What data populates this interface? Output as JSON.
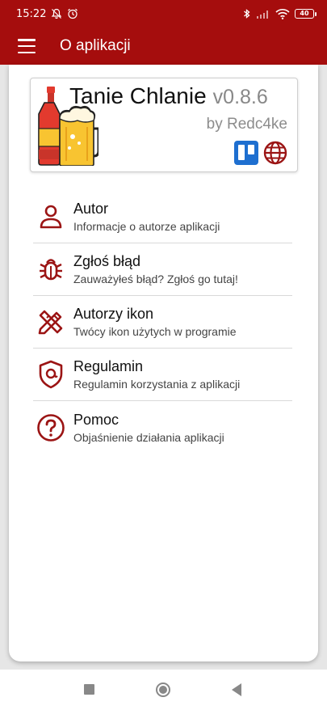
{
  "status_bar": {
    "time": "15:22",
    "battery": "40"
  },
  "app_bar": {
    "title": "O aplikacji"
  },
  "about": {
    "app_name": "Tanie Chlanie",
    "version": "v0.8.6",
    "author": "by Redc4ke"
  },
  "menu": [
    {
      "icon": "user-icon",
      "title": "Autor",
      "description": "Informacje o autorze aplikacji"
    },
    {
      "icon": "bug-icon",
      "title": "Zgłoś błąd",
      "description": "Zauważyłeś błąd? Zgłoś go tutaj!"
    },
    {
      "icon": "design-tools-icon",
      "title": "Autorzy ikon",
      "description": "Twócy ikon użytych w programie"
    },
    {
      "icon": "shield-icon",
      "title": "Regulamin",
      "description": "Regulamin korzystania z aplikacji"
    },
    {
      "icon": "help-icon",
      "title": "Pomoc",
      "description": "Objaśnienie działania aplikacji"
    }
  ],
  "colors": {
    "primary": "#a50d0d",
    "icon_red": "#9b1414",
    "trello_blue": "#1e6fd0"
  }
}
